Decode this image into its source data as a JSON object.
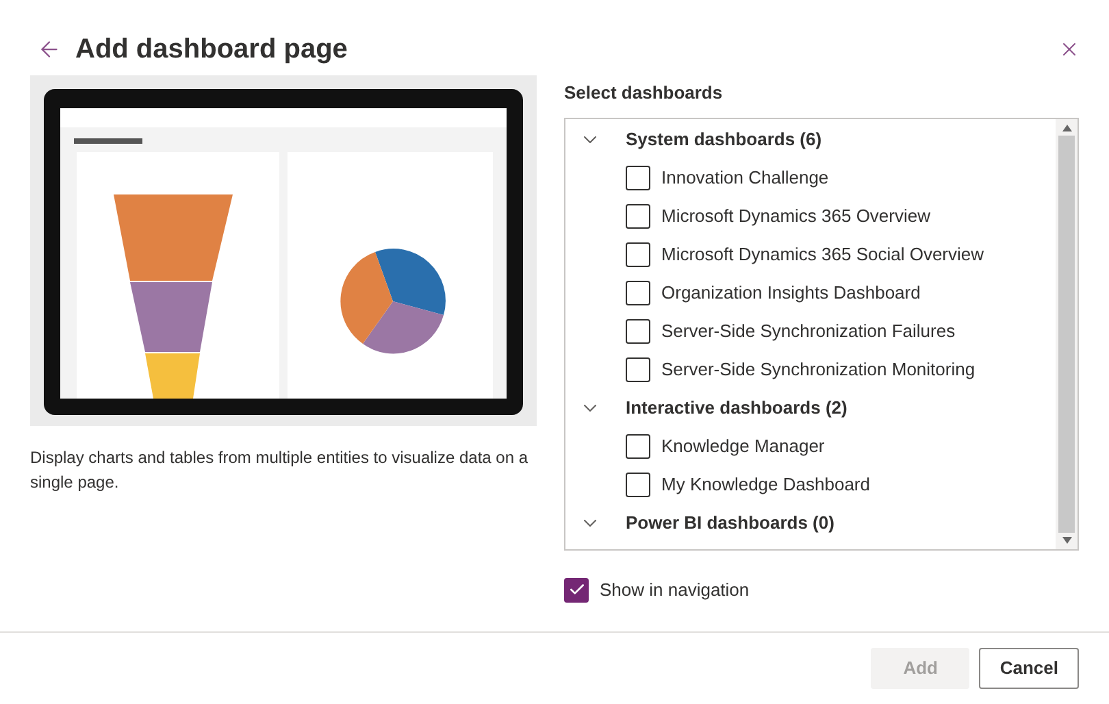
{
  "dialog": {
    "title": "Add dashboard page"
  },
  "description": "Display charts and tables from multiple entities to visualize data on a single page.",
  "list_label": "Select dashboards",
  "groups": [
    {
      "label": "System dashboards (6)",
      "expanded": true,
      "items": [
        {
          "label": "Innovation Challenge",
          "checked": false
        },
        {
          "label": "Microsoft Dynamics 365 Overview",
          "checked": false
        },
        {
          "label": "Microsoft Dynamics 365 Social Overview",
          "checked": false
        },
        {
          "label": "Organization Insights Dashboard",
          "checked": false
        },
        {
          "label": "Server-Side Synchronization Failures",
          "checked": false
        },
        {
          "label": "Server-Side Synchronization Monitoring",
          "checked": false
        }
      ]
    },
    {
      "label": "Interactive dashboards (2)",
      "expanded": true,
      "items": [
        {
          "label": "Knowledge Manager",
          "checked": false
        },
        {
          "label": "My Knowledge Dashboard",
          "checked": false
        }
      ]
    },
    {
      "label": "Power BI dashboards (0)",
      "expanded": true
    }
  ],
  "show_in_navigation": {
    "label": "Show in navigation",
    "checked": true
  },
  "buttons": [
    {
      "label": "Add",
      "disabled": true
    },
    {
      "label": "Cancel",
      "disabled": false
    }
  ]
}
